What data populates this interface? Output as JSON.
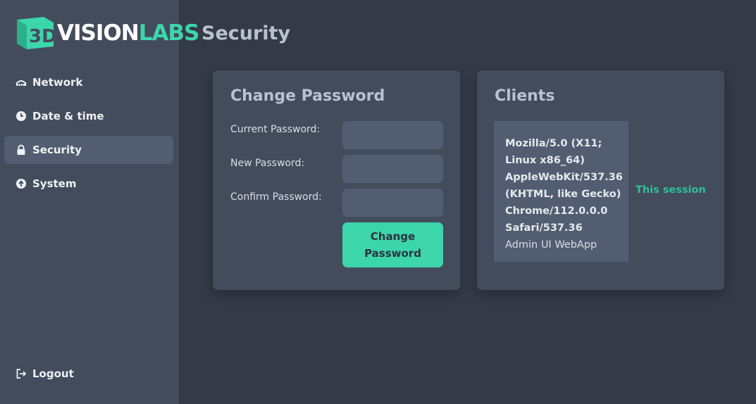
{
  "brand": {
    "badge_text": "3D",
    "name_part1": "VISION",
    "name_part2": "LABS",
    "primary_color": "#3dd5aa"
  },
  "sidebar": {
    "items": [
      {
        "label": "Network",
        "icon": "network-icon",
        "active": false
      },
      {
        "label": "Date & time",
        "icon": "clock-icon",
        "active": false
      },
      {
        "label": "Security",
        "icon": "lock-icon",
        "active": true
      },
      {
        "label": "System",
        "icon": "arrow-up-circle-icon",
        "active": false
      }
    ],
    "logout": {
      "label": "Logout",
      "icon": "logout-icon"
    }
  },
  "page": {
    "title": "Security"
  },
  "change_password": {
    "title": "Change Password",
    "current_label": "Current Password:",
    "current_value": "",
    "new_label": "New Password:",
    "new_value": "",
    "confirm_label": "Confirm Password:",
    "confirm_value": "",
    "button_label": "Change Password"
  },
  "clients": {
    "title": "Clients",
    "entries": [
      {
        "user_agent": "Mozilla/5.0 (X11;\nLinux x86_64)\nAppleWebKit/537.36\n(KHTML, like Gecko)\nChrome/112.0.0.0\nSafari/537.36",
        "app": "Admin UI WebApp",
        "session_label": "This session"
      }
    ]
  },
  "colors": {
    "background": "#343a46",
    "sidebar": "#434c5c",
    "card": "#434c5c",
    "input": "#535d71",
    "accent": "#3dd5aa"
  }
}
